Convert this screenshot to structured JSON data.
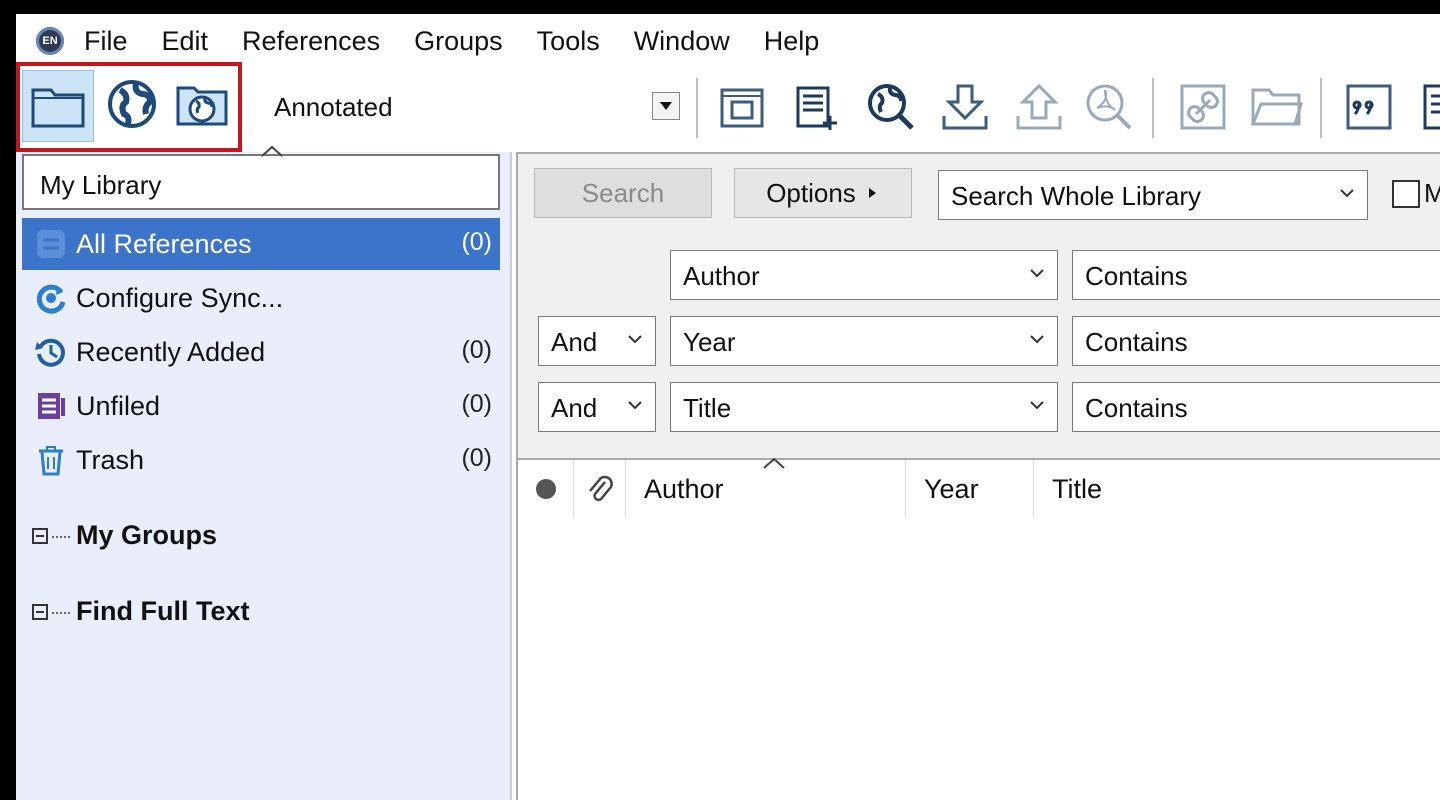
{
  "menubar": {
    "logo_text": "EN",
    "items": [
      "File",
      "Edit",
      "References",
      "Groups",
      "Tools",
      "Window",
      "Help"
    ]
  },
  "toolbar": {
    "mode_select": {
      "selected": "Annotated"
    },
    "icons": [
      "local-library-icon",
      "online-search-icon",
      "integrated-library-icon",
      "new-reference-icon",
      "new-group-icon",
      "online-search-icon",
      "import-icon",
      "export-icon",
      "find-pdf-icon",
      "open-link-icon",
      "open-file-icon",
      "insert-citation-icon",
      "format-bibliography-icon"
    ]
  },
  "left_pane": {
    "library_name": "My Library",
    "groups": [
      {
        "label": "All References",
        "count": "(0)"
      },
      {
        "label": "Configure Sync...",
        "count": ""
      },
      {
        "label": "Recently Added",
        "count": "(0)"
      },
      {
        "label": "Unfiled",
        "count": "(0)"
      },
      {
        "label": "Trash",
        "count": "(0)"
      }
    ],
    "sections": [
      "My Groups",
      "Find Full Text"
    ]
  },
  "search_pane": {
    "search_label": "Search",
    "options_label": "Options",
    "scope": "Search Whole Library",
    "match_case_label": "M",
    "rows": [
      {
        "bool": "",
        "field": "Author",
        "condition": "Contains"
      },
      {
        "bool": "And",
        "field": "Year",
        "condition": "Contains"
      },
      {
        "bool": "And",
        "field": "Title",
        "condition": "Contains"
      }
    ]
  },
  "list_pane": {
    "columns": {
      "author": "Author",
      "year": "Year",
      "title": "Title"
    }
  },
  "colors": {
    "selection": "#3c74c9",
    "highlight_box": "#c4161c",
    "left_pane_bg": "#e9eefa"
  }
}
